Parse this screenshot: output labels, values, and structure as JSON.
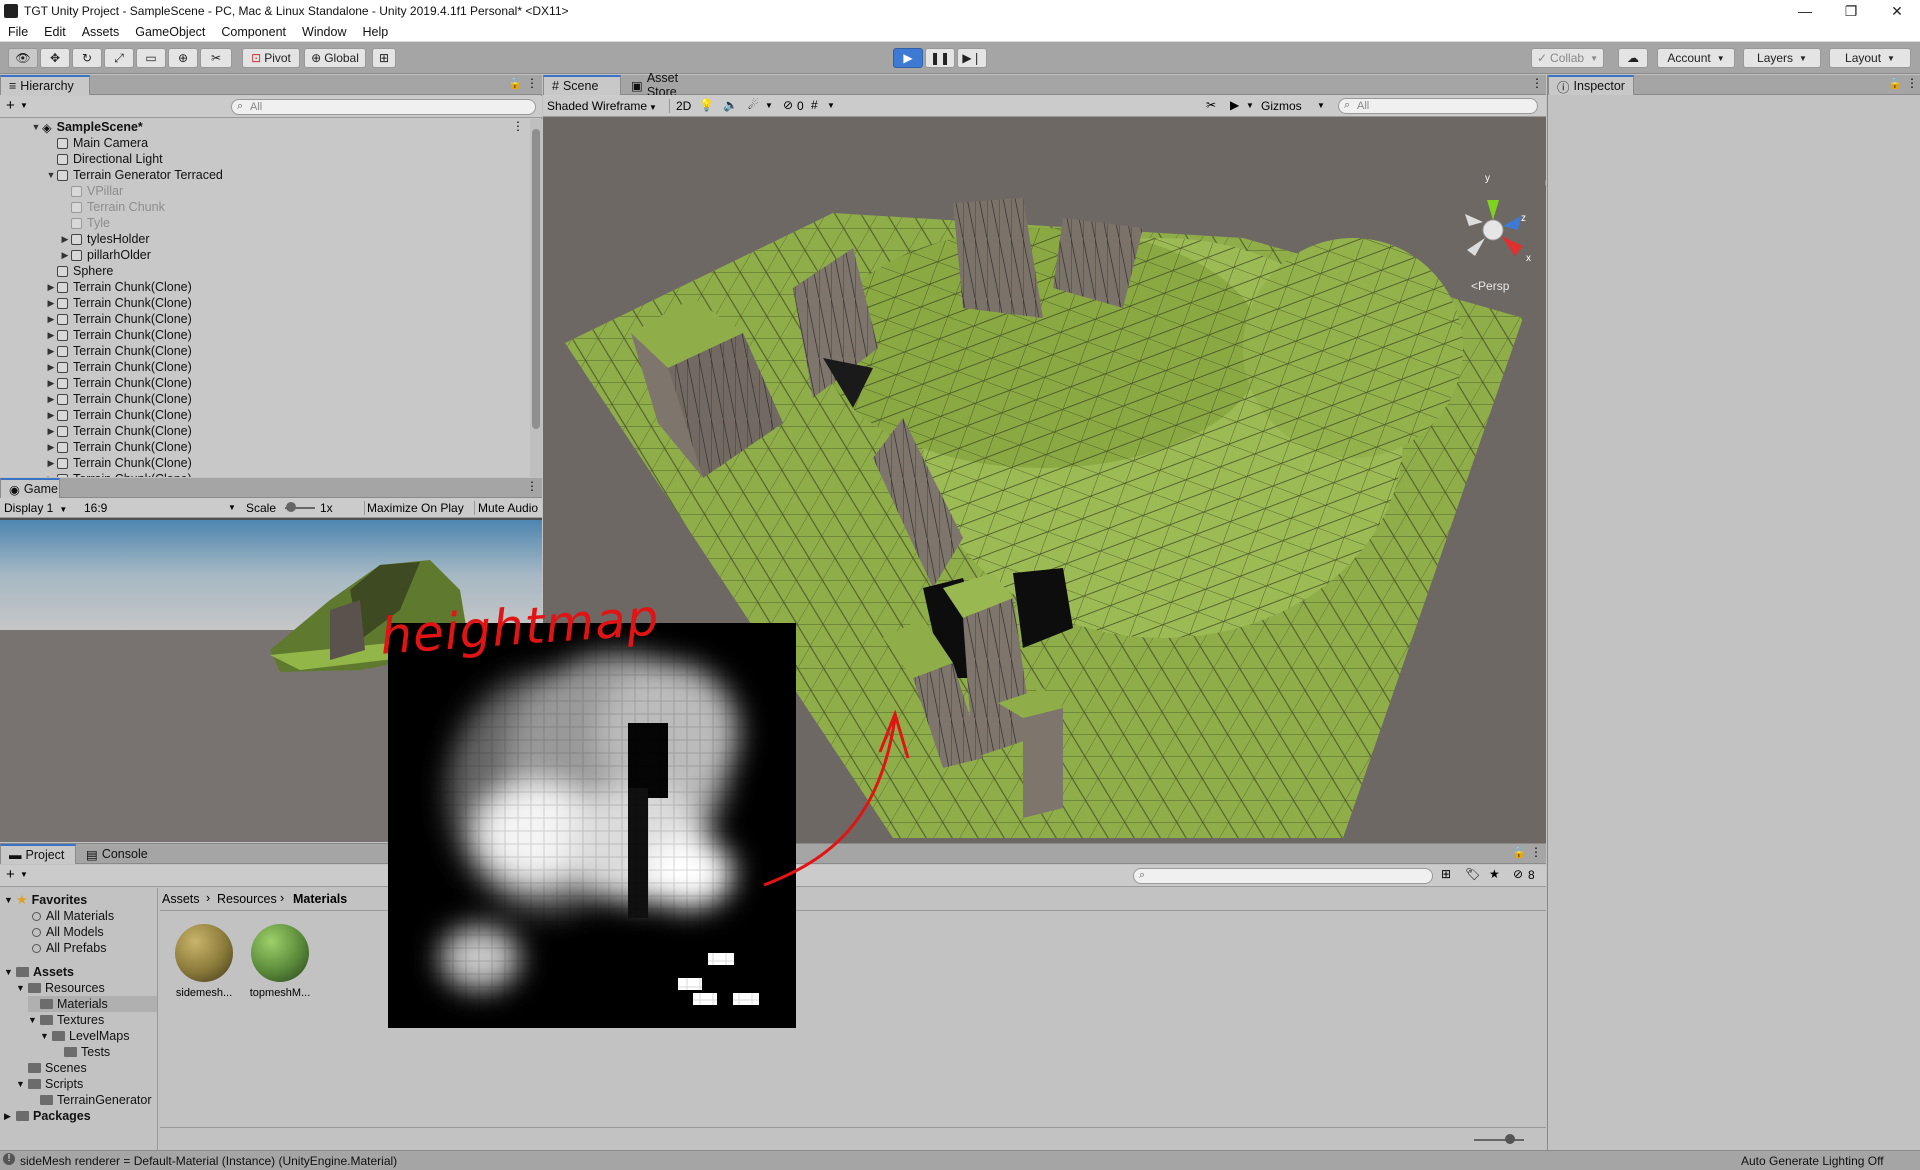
{
  "window": {
    "title": "TGT Unity Project - SampleScene - PC, Mac & Linux Standalone - Unity 2019.4.1f1 Personal* <DX11>",
    "controls": [
      "—",
      "❐",
      "✕"
    ]
  },
  "menu": [
    "File",
    "Edit",
    "Assets",
    "GameObject",
    "Component",
    "Window",
    "Help"
  ],
  "toolbar": {
    "pivot": "Pivot",
    "global": "Global",
    "collab": "Collab",
    "account": "Account",
    "layers": "Layers",
    "layout": "Layout"
  },
  "hierarchy": {
    "tab": "Hierarchy",
    "search_placeholder": "All",
    "scene": "SampleScene*",
    "items": [
      {
        "label": "Main Camera",
        "level": 1,
        "expand": "",
        "disabled": false
      },
      {
        "label": "Directional Light",
        "level": 1,
        "expand": "",
        "disabled": false
      },
      {
        "label": "Terrain Generator Terraced",
        "level": 1,
        "expand": "▼",
        "disabled": false
      },
      {
        "label": "VPillar",
        "level": 2,
        "expand": "",
        "disabled": true
      },
      {
        "label": "Terrain Chunk",
        "level": 2,
        "expand": "",
        "disabled": true
      },
      {
        "label": "Tyle",
        "level": 2,
        "expand": "",
        "disabled": true
      },
      {
        "label": "tylesHolder",
        "level": 2,
        "expand": "▶",
        "disabled": false
      },
      {
        "label": "pillarhOlder",
        "level": 2,
        "expand": "▶",
        "disabled": false
      },
      {
        "label": "Sphere",
        "level": 1,
        "expand": "",
        "disabled": false
      },
      {
        "label": "Terrain Chunk(Clone)",
        "level": 1,
        "expand": "▶",
        "disabled": false
      },
      {
        "label": "Terrain Chunk(Clone)",
        "level": 1,
        "expand": "▶",
        "disabled": false
      },
      {
        "label": "Terrain Chunk(Clone)",
        "level": 1,
        "expand": "▶",
        "disabled": false
      },
      {
        "label": "Terrain Chunk(Clone)",
        "level": 1,
        "expand": "▶",
        "disabled": false
      },
      {
        "label": "Terrain Chunk(Clone)",
        "level": 1,
        "expand": "▶",
        "disabled": false
      },
      {
        "label": "Terrain Chunk(Clone)",
        "level": 1,
        "expand": "▶",
        "disabled": false
      },
      {
        "label": "Terrain Chunk(Clone)",
        "level": 1,
        "expand": "▶",
        "disabled": false
      },
      {
        "label": "Terrain Chunk(Clone)",
        "level": 1,
        "expand": "▶",
        "disabled": false
      },
      {
        "label": "Terrain Chunk(Clone)",
        "level": 1,
        "expand": "▶",
        "disabled": false
      },
      {
        "label": "Terrain Chunk(Clone)",
        "level": 1,
        "expand": "▶",
        "disabled": false
      },
      {
        "label": "Terrain Chunk(Clone)",
        "level": 1,
        "expand": "▶",
        "disabled": false
      },
      {
        "label": "Terrain Chunk(Clone)",
        "level": 1,
        "expand": "▶",
        "disabled": false
      },
      {
        "label": "Terrain Chunk(Clone)",
        "level": 1,
        "expand": "▶",
        "disabled": false
      }
    ]
  },
  "game": {
    "tab": "Game",
    "display": "Display 1",
    "aspect": "16:9",
    "scale_label": "Scale",
    "scale_value": "1x",
    "maximize": "Maximize On Play",
    "mute": "Mute Audio"
  },
  "scene": {
    "tab": "Scene",
    "asset_store_tab": "Asset Store",
    "shading": "Shaded Wireframe",
    "mode_2d": "2D",
    "hidden_count": "0",
    "gizmos": "Gizmos",
    "search_placeholder": "All",
    "persp": "Persp",
    "axis_y": "y",
    "axis_z": "z",
    "axis_x": "x",
    "annotation": "heightmap"
  },
  "inspector": {
    "tab": "Inspector"
  },
  "project": {
    "tab": "Project",
    "console_tab": "Console",
    "hidden_count": "8",
    "favorites": {
      "label": "Favorites",
      "items": [
        "All Materials",
        "All Models",
        "All Prefabs"
      ]
    },
    "tree": [
      {
        "label": "Assets",
        "level": 0,
        "bold": true
      },
      {
        "label": "Resources",
        "level": 1,
        "bold": false
      },
      {
        "label": "Materials",
        "level": 2,
        "bold": false
      },
      {
        "label": "Textures",
        "level": 2,
        "bold": false
      },
      {
        "label": "LevelMaps",
        "level": 3,
        "bold": false
      },
      {
        "label": "Tests",
        "level": 4,
        "bold": false
      },
      {
        "label": "Scenes",
        "level": 1,
        "bold": false
      },
      {
        "label": "Scripts",
        "level": 1,
        "bold": false
      },
      {
        "label": "TerrainGenerator",
        "level": 2,
        "bold": false
      },
      {
        "label": "Packages",
        "level": 0,
        "bold": true
      }
    ],
    "breadcrumb": [
      "Assets",
      "Resources",
      "Materials"
    ],
    "assets": [
      {
        "label": "sidemesh...",
        "color": "#8a7a3a"
      },
      {
        "label": "topmeshM...",
        "color": "#5a8a3a"
      }
    ]
  },
  "status": {
    "message": "sideMesh renderer = Default-Material (Instance) (UnityEngine.Material)",
    "right": "Auto Generate Lighting Off"
  },
  "colors": {
    "terrain": "#8fae4a",
    "play_blue": "#3e7ad3",
    "annotation_red": "#e01414"
  }
}
